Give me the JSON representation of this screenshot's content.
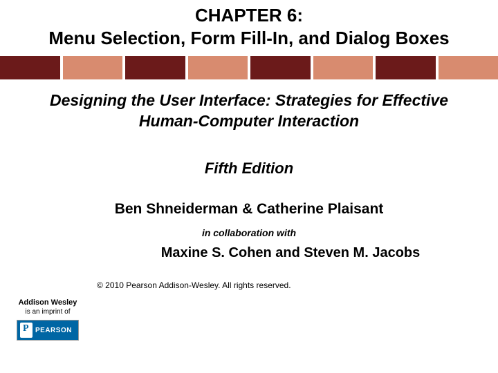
{
  "chapter": {
    "line1": "CHAPTER 6:",
    "line2": "Menu Selection, Form Fill-In, and Dialog Boxes"
  },
  "book": {
    "title": "Designing the User Interface: Strategies for Effective Human-Computer Interaction",
    "edition": "Fifth Edition"
  },
  "authors": {
    "primary": "Ben Shneiderman & Catherine Plaisant",
    "collab_label": "in collaboration with",
    "secondary": "Maxine S. Cohen and Steven M. Jacobs"
  },
  "publisher": {
    "name": "Addison Wesley",
    "imprint_label": "is an imprint of",
    "logo_text": "PEARSON"
  },
  "copyright": "© 2010 Pearson Addison-Wesley. All rights reserved.",
  "stripes": {
    "colors": [
      "dark",
      "light",
      "dark",
      "light",
      "dark",
      "light",
      "dark",
      "light"
    ]
  }
}
